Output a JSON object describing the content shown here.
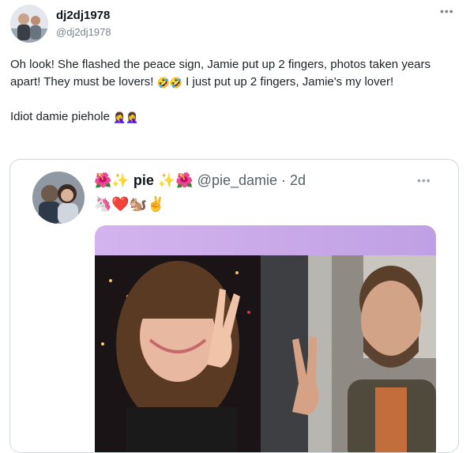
{
  "tweet": {
    "author_name": "dj2dj1978",
    "author_handle": "@dj2dj1978",
    "more_icon": "more-horizontal-icon",
    "paragraph1_a": "Oh look! She flashed the peace sign, Jamie put up 2 fingers, photos taken years apart! They must be lovers! ",
    "paragraph1_emoji": "🤣🤣",
    "paragraph1_b": " I just put up 2 fingers, Jamie's my lover!",
    "paragraph2_text": "Idiot damie piehole ",
    "paragraph2_emoji": "🤦‍♀️🤦‍♀️"
  },
  "quoted": {
    "name_prefix": "🌺✨ ",
    "name": "pie",
    "name_suffix": " ✨🌺 ",
    "handle": "@pie_damie",
    "separator": " · ",
    "time": "2d",
    "emoji_line": "🦄❤️🐿️✌️",
    "more_icon": "more-horizontal-icon"
  },
  "colors": {
    "link_gray": "#7b8389",
    "border": "#cfd9de",
    "media_banner": "#c8a6e6"
  }
}
